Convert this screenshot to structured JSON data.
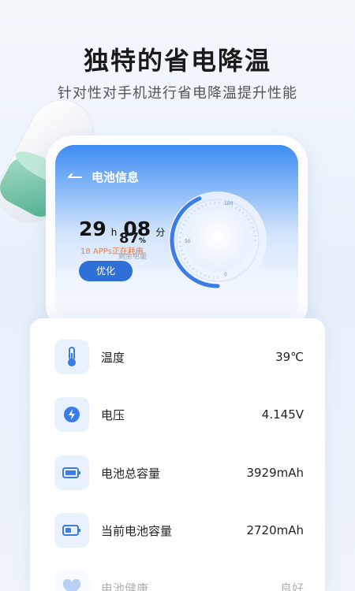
{
  "promo": {
    "headline": "独特的省电降温",
    "subline": "针对性对手机进行省电降温提升性能"
  },
  "screen": {
    "nav_title": "电池信息",
    "remaining_time": {
      "hours": "29",
      "hour_unit": "h",
      "minutes": "08",
      "minute_unit": "分"
    },
    "apps_text": "18 APPs正在耗电",
    "optimize_button": "优化",
    "gauge": {
      "percent": "87",
      "percent_unit": "%",
      "label": "剩余电量",
      "level": 0.87,
      "tick_labels": [
        "100",
        "50",
        "0"
      ]
    }
  },
  "info": {
    "items": [
      {
        "label": "温度",
        "value": "39℃",
        "icon": "thermometer-icon"
      },
      {
        "label": "电压",
        "value": "4.145V",
        "icon": "bolt-icon"
      },
      {
        "label": "电池总容量",
        "value": "3929mAh",
        "icon": "battery-full-icon"
      },
      {
        "label": "当前电池容量",
        "value": "2720mAh",
        "icon": "battery-half-icon"
      },
      {
        "label": "电池健康",
        "value": "良好",
        "icon": "health-icon"
      }
    ]
  },
  "colors": {
    "accent": "#2f6fd8",
    "warning_text": "#ef7b45",
    "icon_bg": "#e9f1fd",
    "icon_blue": "#3b7ce6"
  }
}
